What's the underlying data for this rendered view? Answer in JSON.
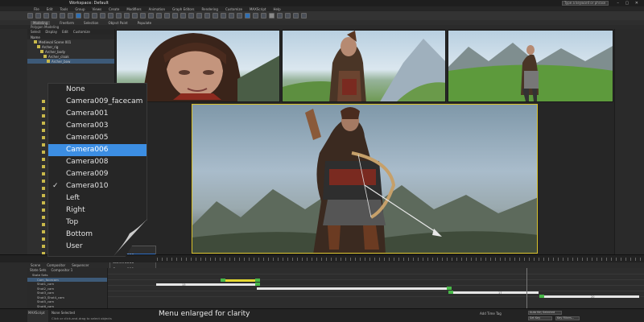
{
  "window": {
    "workspace_label": "Workspace: Default",
    "search_placeholder": "Type a keyword or phrase",
    "controls": "– ▢ ✕"
  },
  "menubar": [
    "File",
    "Edit",
    "Tools",
    "Group",
    "Views",
    "Create",
    "Modifiers",
    "Animation",
    "Graph Editors",
    "Rendering",
    "Customize",
    "MAXScript",
    "Help"
  ],
  "ribbon": {
    "tabs": [
      "Modeling",
      "Freeform",
      "Selection",
      "Object Paint",
      "Populate"
    ],
    "sub": "Polygon Modeling"
  },
  "scene_explorer": {
    "tabs": [
      "Select",
      "Display",
      "Edit",
      "Customize"
    ],
    "header": "Name",
    "rows": [
      "Medieval Scene 001",
      "Archer_rig",
      "Archer_body",
      "Archer_cloak",
      "Archer_bow"
    ]
  },
  "viewport_menu": {
    "items": [
      "None",
      "Camera009_facecam",
      "Camera001",
      "Camera003",
      "Camera005",
      "Camera006",
      "Camera008",
      "Camera009",
      "Camera010",
      "Left",
      "Right",
      "Top",
      "Bottom",
      "User"
    ],
    "selected": "Camera006",
    "checked": "Camera010"
  },
  "small_menu": {
    "items": [
      "005",
      "Camera006",
      "Camera008",
      "Camera009",
      "Camera010",
      "Left",
      "Right",
      "Top",
      "Bottom",
      "User"
    ],
    "selected": "Camera006"
  },
  "workspace_button": "Workspace: Default",
  "bottom_tabs": [
    "Scene",
    "Compositor",
    "Sequencer"
  ],
  "state_sets": {
    "tabs": [
      "State Sets",
      "Compositor 1"
    ],
    "rows": [
      "State Sets",
      "Cam_facecam",
      "Shot1_cam",
      "Shot2_cam",
      "Shot3_cam",
      "Shot3_Shot4_cam",
      "Shot5_cam",
      "Shot6_cam"
    ]
  },
  "track_labels": [
    "13",
    "17",
    "20"
  ],
  "status": {
    "maxscript": "MAXScript",
    "line1": "None Selected",
    "line2": "Click or click-and-drag to select objects",
    "caption": "Menu enlarged for clarity",
    "time_readout": "Add Time Tag",
    "selected_box": "Selected",
    "autokey": "Auto Key",
    "set_key": "Set Key",
    "key_filters": "Key Filters..."
  }
}
